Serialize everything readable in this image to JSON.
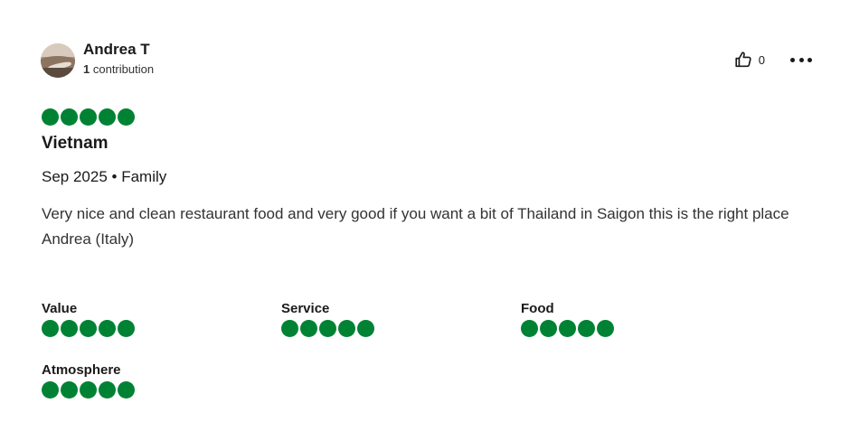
{
  "reviewer": {
    "name": "Andrea T",
    "contributions_count": "1",
    "contributions_label": "contribution"
  },
  "helpful": {
    "count": "0"
  },
  "icons": {
    "helpful": "thumbs-up-icon",
    "menu": "more-horizontal-icon"
  },
  "review": {
    "rating": 5,
    "rating_max": 5,
    "title": "Vietnam",
    "meta": "Sep 2025 • Family",
    "text_line": "Very nice and clean restaurant food and very good if you want a bit of Thailand in Saigon this is the right place",
    "signature": "Andrea (Italy)"
  },
  "subratings": [
    {
      "label": "Value",
      "rating": 5
    },
    {
      "label": "Service",
      "rating": 5
    },
    {
      "label": "Food",
      "rating": 5
    },
    {
      "label": "Atmosphere",
      "rating": 5
    }
  ],
  "colors": {
    "bubble": "#008234",
    "text": "#1a1a1a"
  }
}
